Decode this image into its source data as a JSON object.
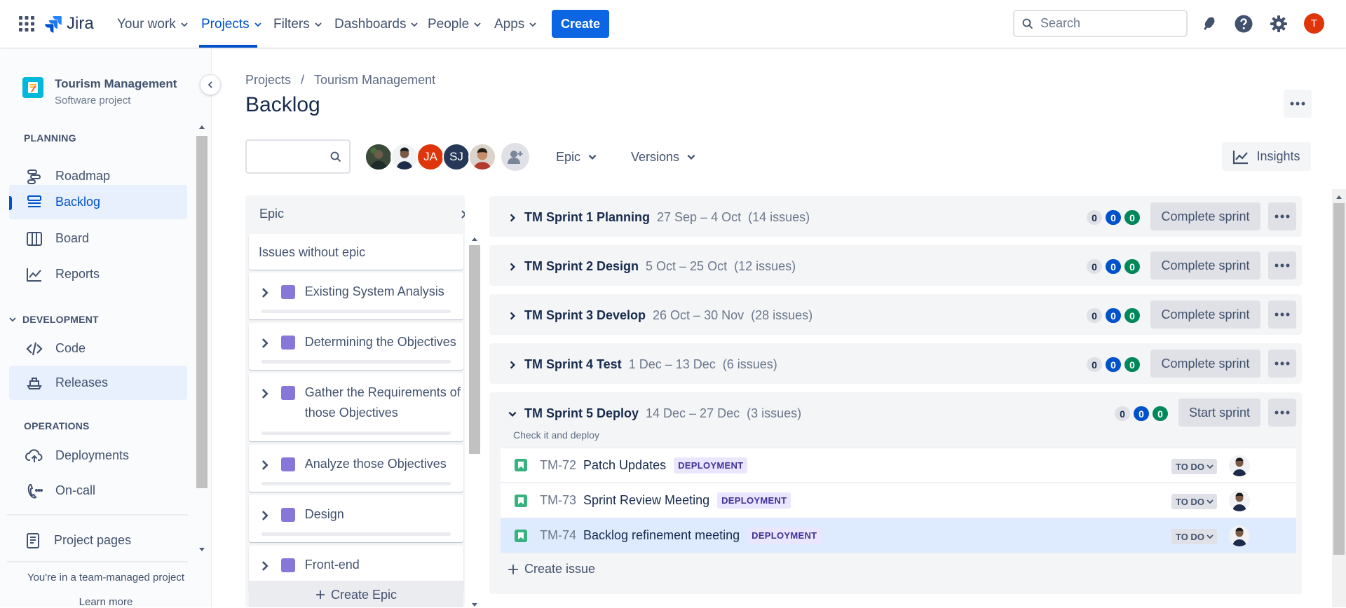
{
  "topnav": {
    "logo_text": "Jira",
    "items": [
      {
        "label": "Your work"
      },
      {
        "label": "Projects"
      },
      {
        "label": "Filters"
      },
      {
        "label": "Dashboards"
      },
      {
        "label": "People"
      },
      {
        "label": "Apps"
      }
    ],
    "active_item": "Projects",
    "create_label": "Create",
    "search_placeholder": "Search",
    "user_initial": "T",
    "icons": [
      "app-switcher-icon",
      "jira-logo-icon",
      "notifications-icon",
      "help-icon",
      "settings-icon"
    ],
    "colors": {
      "accent": "#0052cc",
      "create_button": "#0c66e4",
      "avatar": "#de350b"
    }
  },
  "sidebar": {
    "project_name": "Tourism Management",
    "project_type": "Software project",
    "planning_title": "PLANNING",
    "planning_items": [
      {
        "label": "Roadmap",
        "icon": "roadmap-icon"
      },
      {
        "label": "Backlog",
        "icon": "backlog-icon",
        "selected": true
      },
      {
        "label": "Board",
        "icon": "board-icon"
      },
      {
        "label": "Reports",
        "icon": "reports-icon"
      }
    ],
    "development_title": "DEVELOPMENT",
    "development_items": [
      {
        "label": "Code",
        "icon": "code-icon"
      },
      {
        "label": "Releases",
        "icon": "releases-icon"
      }
    ],
    "operations_title": "OPERATIONS",
    "operations_items": [
      {
        "label": "Deployments",
        "icon": "deployments-icon"
      },
      {
        "label": "On-call",
        "icon": "on-call-icon"
      }
    ],
    "project_pages": "Project pages",
    "footer_text": "You're in a team-managed project",
    "learn_more": "Learn more"
  },
  "main": {
    "breadcrumb": [
      "Projects",
      "Tourism Management"
    ],
    "breadcrumb_separator": "/",
    "title": "Backlog",
    "avatar_initials": [
      "JA",
      "SJ"
    ],
    "epic_filter": "Epic",
    "versions_filter": "Versions",
    "insights_label": "Insights"
  },
  "epic_panel": {
    "title": "Epic",
    "issues_without_epic": "Issues without epic",
    "epics": [
      "Existing System Analysis",
      "Determining the Objectives",
      "Gather the Requirements of those Objectives",
      "Analyze those Objectives",
      "Design",
      "Front-end"
    ],
    "create_label": "Create Epic",
    "epic_color": "#8777d9"
  },
  "sprints": [
    {
      "name": "TM Sprint 1 Planning",
      "dates": "27 Sep – 4 Oct",
      "issues": "(14 issues)",
      "counts": [
        "0",
        "0",
        "0"
      ],
      "action": "Complete sprint"
    },
    {
      "name": "TM Sprint 2 Design",
      "dates": "5 Oct – 25 Oct",
      "issues": "(12 issues)",
      "counts": [
        "0",
        "0",
        "0"
      ],
      "action": "Complete sprint"
    },
    {
      "name": "TM Sprint 3 Develop",
      "dates": "26 Oct – 30 Nov",
      "issues": "(28 issues)",
      "counts": [
        "0",
        "0",
        "0"
      ],
      "action": "Complete sprint"
    },
    {
      "name": "TM Sprint 4 Test",
      "dates": "1 Dec – 13 Dec",
      "issues": "(6 issues)",
      "counts": [
        "0",
        "0",
        "0"
      ],
      "action": "Complete sprint"
    },
    {
      "name": "TM Sprint 5 Deploy",
      "dates": "14 Dec – 27 Dec",
      "issues": "(3 issues)",
      "counts": [
        "0",
        "0",
        "0"
      ],
      "action": "Start sprint",
      "goal": "Check it and deploy",
      "issue_list": [
        {
          "key": "TM-72",
          "summary": "Patch Updates",
          "label": "DEPLOYMENT",
          "status": "TO DO"
        },
        {
          "key": "TM-73",
          "summary": "Sprint Review Meeting",
          "label": "DEPLOYMENT",
          "status": "TO DO"
        },
        {
          "key": "TM-74",
          "summary": "Backlog refinement meeting",
          "label": "DEPLOYMENT",
          "status": "TO DO"
        }
      ],
      "create_issue": "Create issue"
    }
  ],
  "status_colors": {
    "todo": "#dfe1e6",
    "in_progress": "#0052cc",
    "done": "#00875a"
  }
}
